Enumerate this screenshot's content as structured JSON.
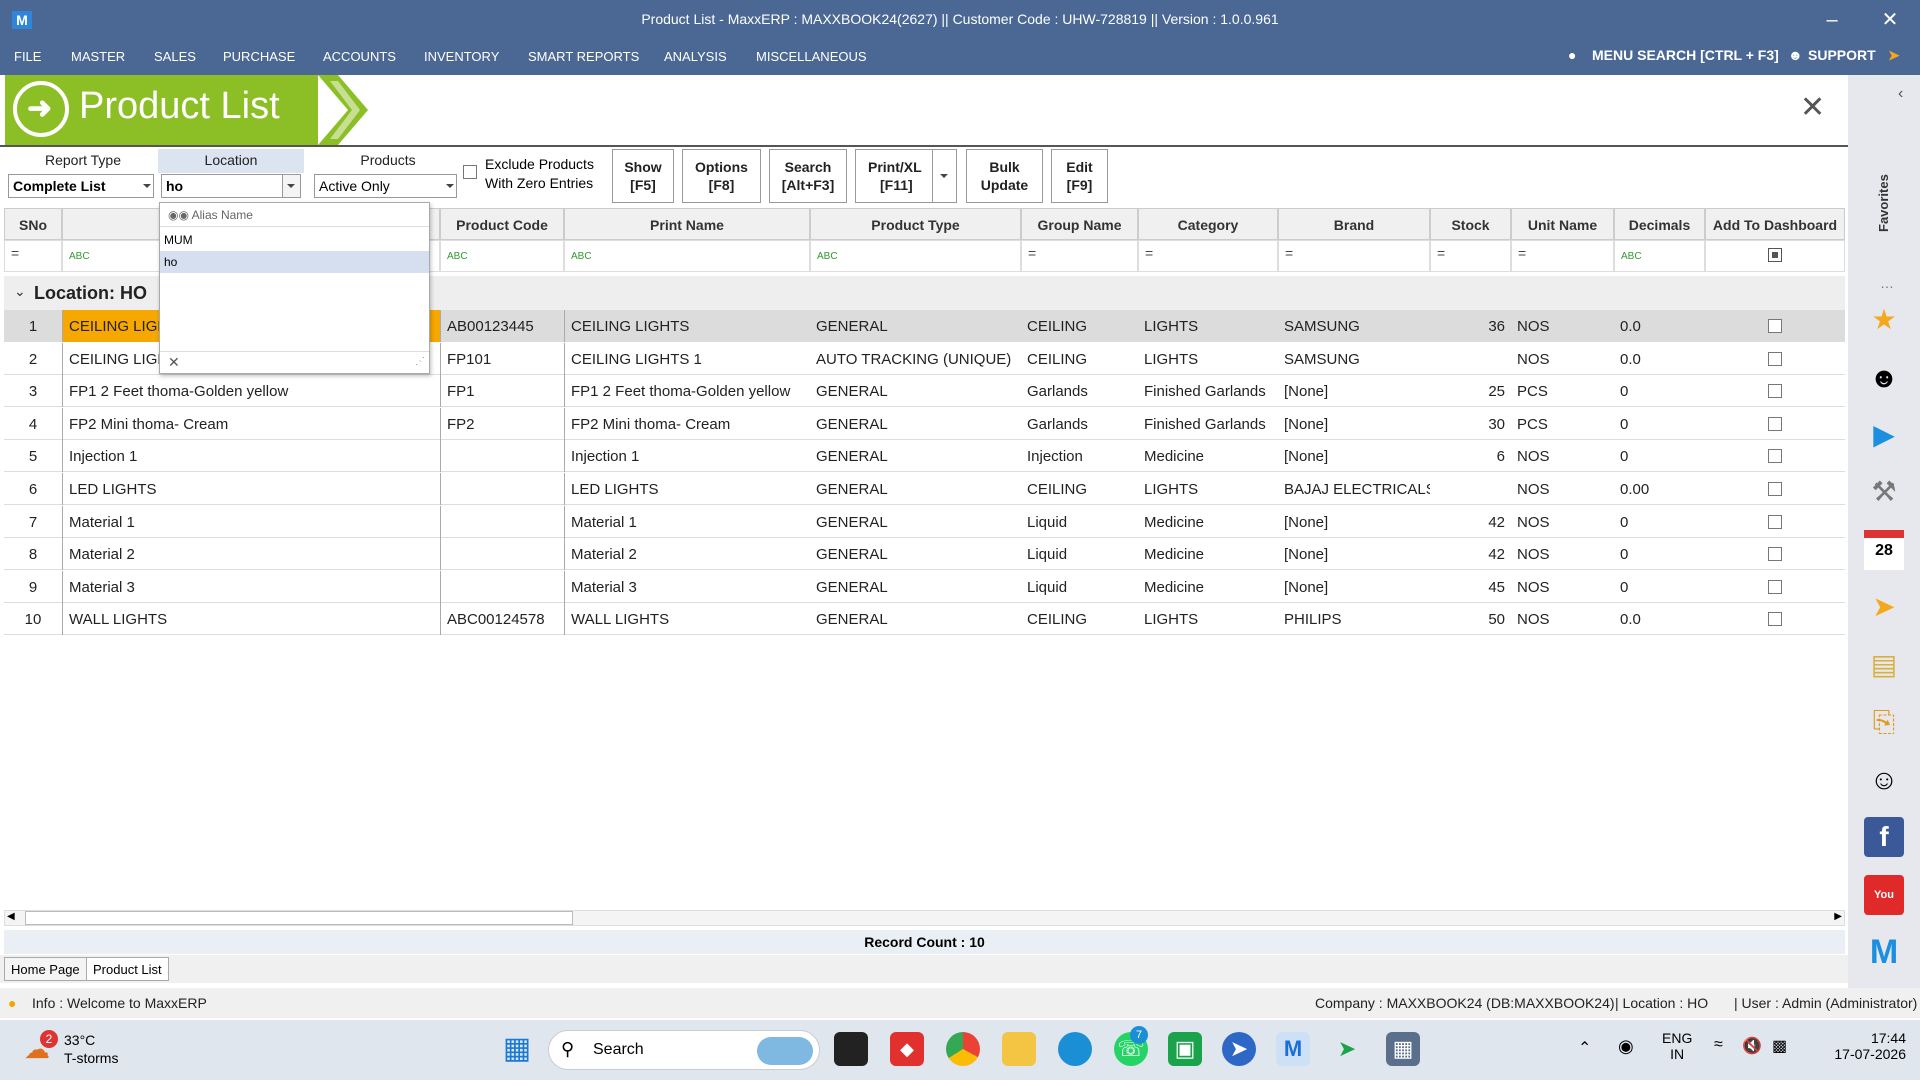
{
  "window": {
    "title": "Product List - MaxxERP : MAXXBOOK24(2627)  ||  Customer Code : UHW-728819  ||  Version : 1.0.0.961",
    "logo": "M"
  },
  "menu": {
    "items": [
      "FILE",
      "MASTER",
      "SALES",
      "PURCHASE",
      "ACCOUNTS",
      "INVENTORY",
      "SMART REPORTS",
      "ANALYSIS",
      "MISCELLANEOUS"
    ],
    "search": "MENU SEARCH [CTRL + F3]",
    "support": "SUPPORT"
  },
  "page": {
    "title": "Product List",
    "close": "✕"
  },
  "filters": {
    "report_type_label": "Report Type",
    "report_type_value": "Complete List",
    "location_label": "Location",
    "location_value": "ho",
    "products_label": "Products",
    "products_value": "Active Only",
    "exclude_line1": "Exclude Products",
    "exclude_line2": "With Zero Entries"
  },
  "toolbar": {
    "show": [
      "Show",
      "[F5]"
    ],
    "options": [
      "Options",
      "[F8]"
    ],
    "search": [
      "Search",
      "[Alt+F3]"
    ],
    "print": [
      "Print/XL",
      "[F11]"
    ],
    "bulk": [
      "Bulk",
      "Update"
    ],
    "edit": [
      "Edit",
      "[F9]"
    ]
  },
  "dropdown": {
    "header": "Alias Name",
    "options": [
      "MUM",
      "ho"
    ],
    "selected": "ho"
  },
  "columns": [
    "SNo",
    "",
    "Product Code",
    "Print Name",
    "Product Type",
    "Group Name",
    "Category",
    "Brand",
    "Stock",
    "Unit Name",
    "Decimals",
    "Add To Dashboard"
  ],
  "group_label": "Location: HO",
  "rows": [
    [
      "1",
      "CEILING LIGH",
      "AB00123445",
      "CEILING LIGHTS",
      "GENERAL",
      "CEILING",
      "LIGHTS",
      "SAMSUNG",
      "36",
      "NOS",
      "0.0"
    ],
    [
      "2",
      "CEILING LIGH",
      "FP101",
      "CEILING LIGHTS 1",
      "AUTO TRACKING (UNIQUE)",
      "CEILING",
      "LIGHTS",
      "SAMSUNG",
      "",
      "NOS",
      "0.0"
    ],
    [
      "3",
      "FP1 2 Feet thoma-Golden yellow",
      "FP1",
      "FP1 2 Feet thoma-Golden yellow",
      "GENERAL",
      "Garlands",
      "Finished Garlands",
      "[None]",
      "25",
      "PCS",
      "0"
    ],
    [
      "4",
      "FP2 Mini thoma- Cream",
      "FP2",
      "FP2 Mini thoma- Cream",
      "GENERAL",
      "Garlands",
      "Finished Garlands",
      "[None]",
      "30",
      "PCS",
      "0"
    ],
    [
      "5",
      "Injection 1",
      "",
      "Injection 1",
      "GENERAL",
      "Injection",
      "Medicine",
      "[None]",
      "6",
      "NOS",
      "0"
    ],
    [
      "6",
      "LED LIGHTS",
      "",
      "LED LIGHTS",
      "GENERAL",
      "CEILING",
      "LIGHTS",
      "BAJAJ ELECTRICALS",
      "",
      "NOS",
      "0.00"
    ],
    [
      "7",
      "Material 1",
      "",
      "Material 1",
      "GENERAL",
      "Liquid",
      "Medicine",
      "[None]",
      "42",
      "NOS",
      "0"
    ],
    [
      "8",
      "Material 2",
      "",
      "Material 2",
      "GENERAL",
      "Liquid",
      "Medicine",
      "[None]",
      "42",
      "NOS",
      "0"
    ],
    [
      "9",
      "Material 3",
      "",
      "Material 3",
      "GENERAL",
      "Liquid",
      "Medicine",
      "[None]",
      "45",
      "NOS",
      "0"
    ],
    [
      "10",
      "WALL LIGHTS",
      "ABC00124578",
      "WALL LIGHTS",
      "GENERAL",
      "CEILING",
      "LIGHTS",
      "PHILIPS",
      "50",
      "NOS",
      "0.0"
    ]
  ],
  "record_count": "Record Count : 10",
  "tabs": [
    "Home Page",
    "Product List"
  ],
  "status": {
    "info": "Info : Welcome to MaxxERP",
    "company": "Company : MAXXBOOK24 (DB:MAXXBOOK24)",
    "location": "| Location : HO",
    "user": "| User : Admin (Administrator)"
  },
  "sidebar": {
    "favorites": "Favorites"
  },
  "taskbar": {
    "weather_temp": "33°C",
    "weather_desc": "T-storms",
    "weather_badge": "2",
    "search": "Search",
    "whatsapp_badge": "7",
    "lang1": "ENG",
    "lang2": "IN",
    "time": "17:44",
    "date": "17-07-2026"
  }
}
